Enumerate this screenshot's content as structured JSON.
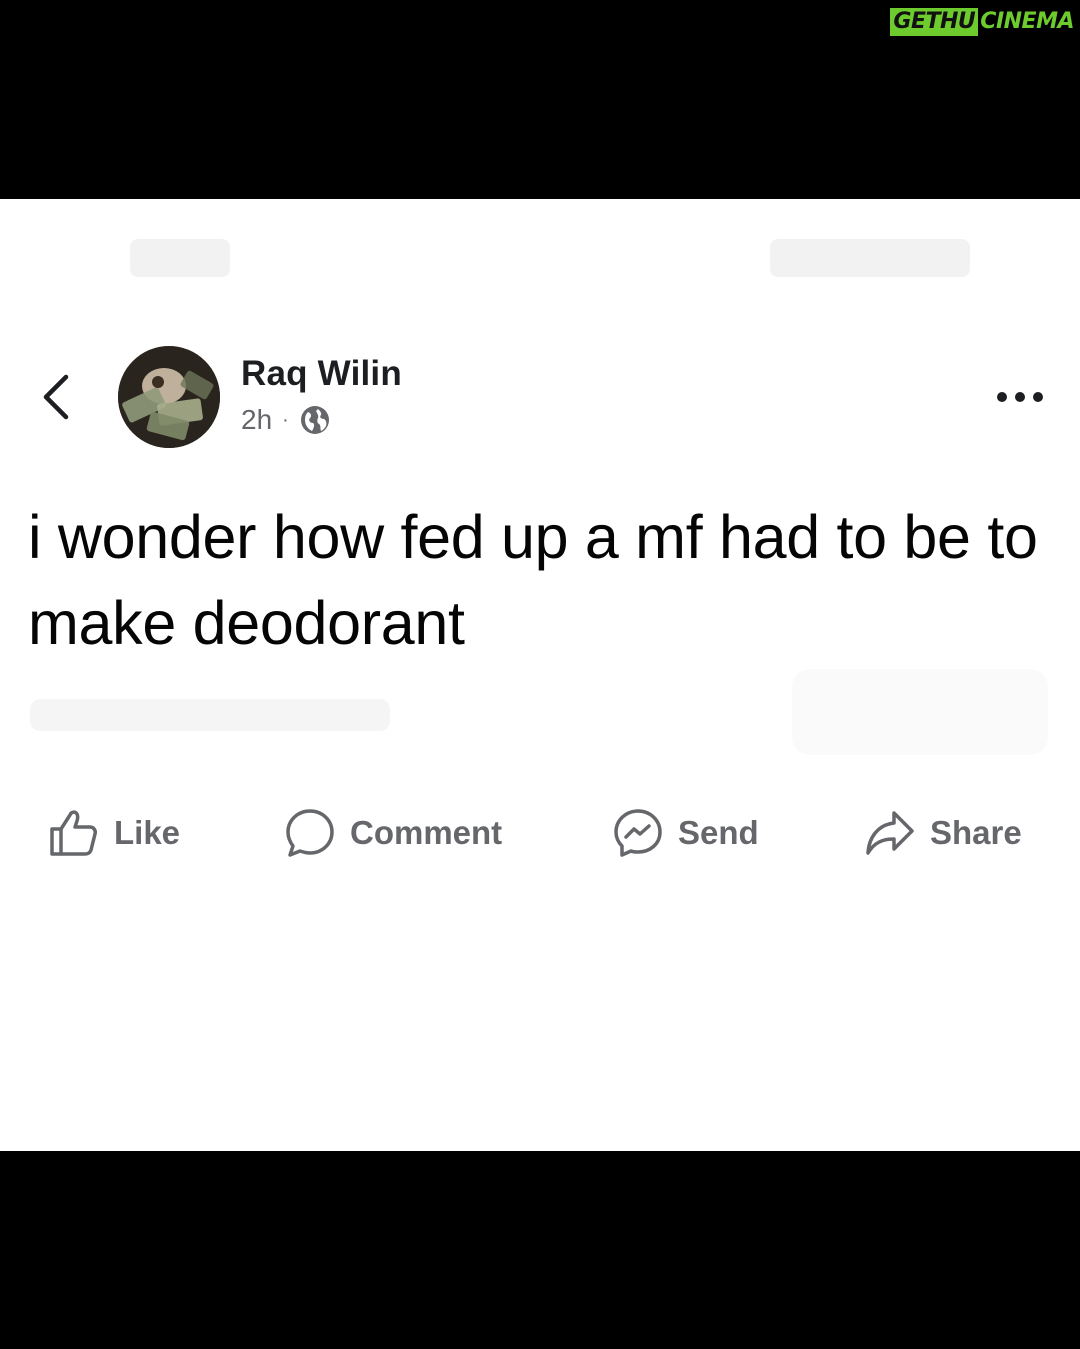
{
  "watermark": {
    "part1": "GETHU",
    "part2": "CINEMA",
    "accent": "#6ecb2e"
  },
  "post": {
    "author": "Raq Wilin",
    "time": "2h",
    "separator": "·",
    "privacy_icon": "globe-icon",
    "text": "i wonder how fed up a mf had to be to make deodorant"
  },
  "nav": {
    "back_icon": "chevron-left-icon",
    "more_icon": "more-horizontal-icon"
  },
  "actions": [
    {
      "label": "Like",
      "icon": "thumbs-up-icon"
    },
    {
      "label": "Comment",
      "icon": "comment-bubble-icon"
    },
    {
      "label": "Send",
      "icon": "messenger-icon"
    },
    {
      "label": "Share",
      "icon": "share-arrow-icon"
    }
  ],
  "colors": {
    "text": "#050505",
    "secondary": "#65676b",
    "background": "#ffffff",
    "frame": "#000000"
  }
}
